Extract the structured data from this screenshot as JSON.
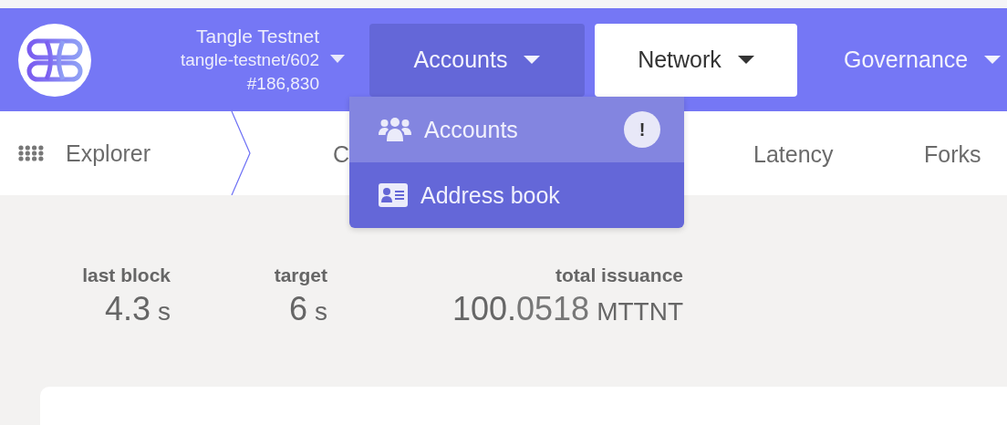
{
  "chain": {
    "name": "Tangle Testnet",
    "spec": "tangle-testnet/602",
    "block": "#186,830"
  },
  "nav": [
    {
      "label": "Accounts",
      "selected": false,
      "open": true
    },
    {
      "label": "Network",
      "selected": true,
      "open": false
    },
    {
      "label": "Governance",
      "selected": false,
      "open": false
    }
  ],
  "dropdown": [
    {
      "kind": "accounts",
      "label": "Accounts",
      "selected": true,
      "badge": "!"
    },
    {
      "kind": "addressbook",
      "label": "Address book",
      "selected": false
    }
  ],
  "subnav": [
    {
      "label": "Explorer",
      "kind": "home"
    },
    {
      "label": "C",
      "kind": "tab"
    },
    {
      "label": "Latency",
      "kind": "tab"
    },
    {
      "label": "Forks",
      "kind": "tab"
    }
  ],
  "stats": [
    {
      "label": "last block",
      "value": "4.3",
      "unit": "s"
    },
    {
      "label": "target",
      "value": "6",
      "unit": "s"
    },
    {
      "label": "total issuance",
      "value": "100.",
      "fraction": "0518",
      "unit": "MTTNT"
    }
  ]
}
